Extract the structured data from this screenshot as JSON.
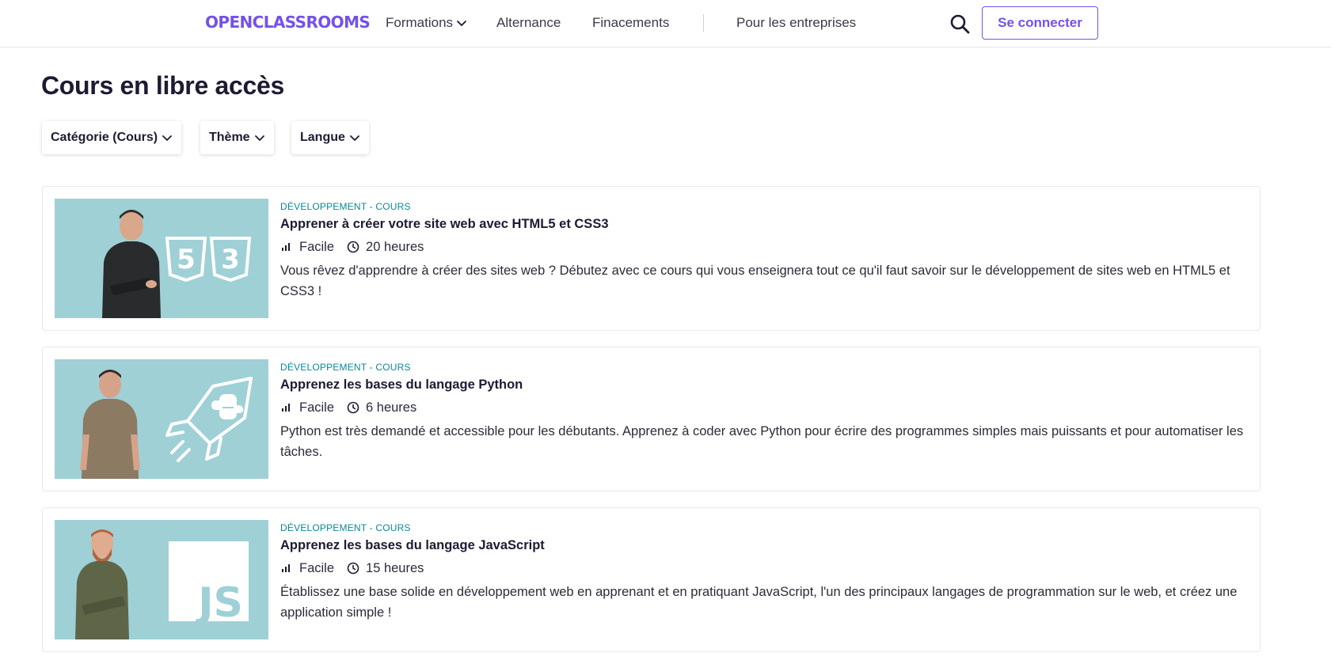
{
  "header": {
    "logo_text": "OPENCLASSROOMS",
    "nav": {
      "formations": "Formations",
      "alternance": "Alternance",
      "financements": "Finacements",
      "entreprises": "Pour les entreprises"
    },
    "login_label": "Se connecter"
  },
  "page": {
    "title": "Cours en libre accès"
  },
  "filters": {
    "category": "Catégorie (Cours)",
    "theme": "Thème",
    "language": "Langue"
  },
  "courses": [
    {
      "category": "DÉVELOPPEMENT - COURS",
      "title": "Apprener à créer votre site web avec HTML5 et CSS3",
      "level": "Facile",
      "duration": "20 heures",
      "description": "Vous rêvez d'apprendre à créer des sites web ? Débutez avec ce cours qui vous enseignera tout ce qu'il faut savoir sur le développement de sites web en HTML5 et CSS3 !",
      "thumb_logo": "html5-css3"
    },
    {
      "category": "DÉVELOPPEMENT - COURS",
      "title": "Apprenez les bases du langage Python",
      "level": "Facile",
      "duration": "6 heures",
      "description": "Python est très demandé et accessible pour les débutants. Apprenez à coder avec Python pour écrire des programmes simples mais puissants et pour automatiser les tâches.",
      "thumb_logo": "python-rocket"
    },
    {
      "category": "DÉVELOPPEMENT - COURS",
      "title": "Apprenez les bases du langage JavaScript",
      "level": "Facile",
      "duration": "15 heures",
      "description": "Établissez une base solide en développement web en apprenant et en pratiquant JavaScript, l'un des principaux langages de programmation sur le web, et créez une application simple !",
      "thumb_logo": "js",
      "thumb_text": "JS"
    }
  ],
  "colors": {
    "brand": "#7451eb",
    "category": "#0a8895",
    "thumb_bg": "#9fd0d6"
  }
}
